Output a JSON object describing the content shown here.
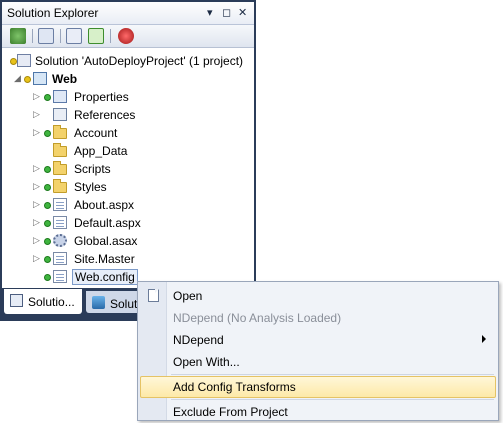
{
  "panel": {
    "title": "Solution Explorer",
    "pin_glyph": "▾",
    "dock_glyph": "◻",
    "close_glyph": "✕",
    "toolbar": [
      "properties-icon",
      "show-all-files-icon",
      "copy-website-icon",
      "refresh-icon",
      "class-diagram-icon"
    ]
  },
  "tree": {
    "solution": "Solution 'AutoDeployProject' (1 project)",
    "project": "Web",
    "items": [
      {
        "label": "Properties",
        "icon": "properties-icon"
      },
      {
        "label": "References",
        "icon": "references-icon"
      },
      {
        "label": "Account",
        "icon": "folder-icon"
      },
      {
        "label": "App_Data",
        "icon": "folder-icon"
      },
      {
        "label": "Scripts",
        "icon": "folder-icon"
      },
      {
        "label": "Styles",
        "icon": "folder-icon"
      },
      {
        "label": "About.aspx",
        "icon": "aspx-file-icon"
      },
      {
        "label": "Default.aspx",
        "icon": "aspx-file-icon"
      },
      {
        "label": "Global.asax",
        "icon": "asax-file-icon"
      },
      {
        "label": "Site.Master",
        "icon": "master-file-icon"
      },
      {
        "label": "Web.config",
        "icon": "config-file-icon"
      }
    ]
  },
  "tabs": [
    {
      "label": "Solutio...",
      "active": true
    },
    {
      "label": "Solut",
      "active": false
    }
  ],
  "context_menu": {
    "items": [
      {
        "label": "Open",
        "disabled": false
      },
      {
        "label": "NDepend (No Analysis Loaded)",
        "disabled": true
      },
      {
        "label": "NDepend",
        "submenu": true
      },
      {
        "label": "Open With..."
      },
      {
        "label": "Add Config Transforms",
        "highlighted": true
      },
      {
        "label": "Exclude From Project"
      }
    ]
  },
  "colors": {
    "panel_frame": "#2b3c59",
    "menu_highlight": "#fde9a8",
    "source_control_dot": "#3fb43f"
  }
}
